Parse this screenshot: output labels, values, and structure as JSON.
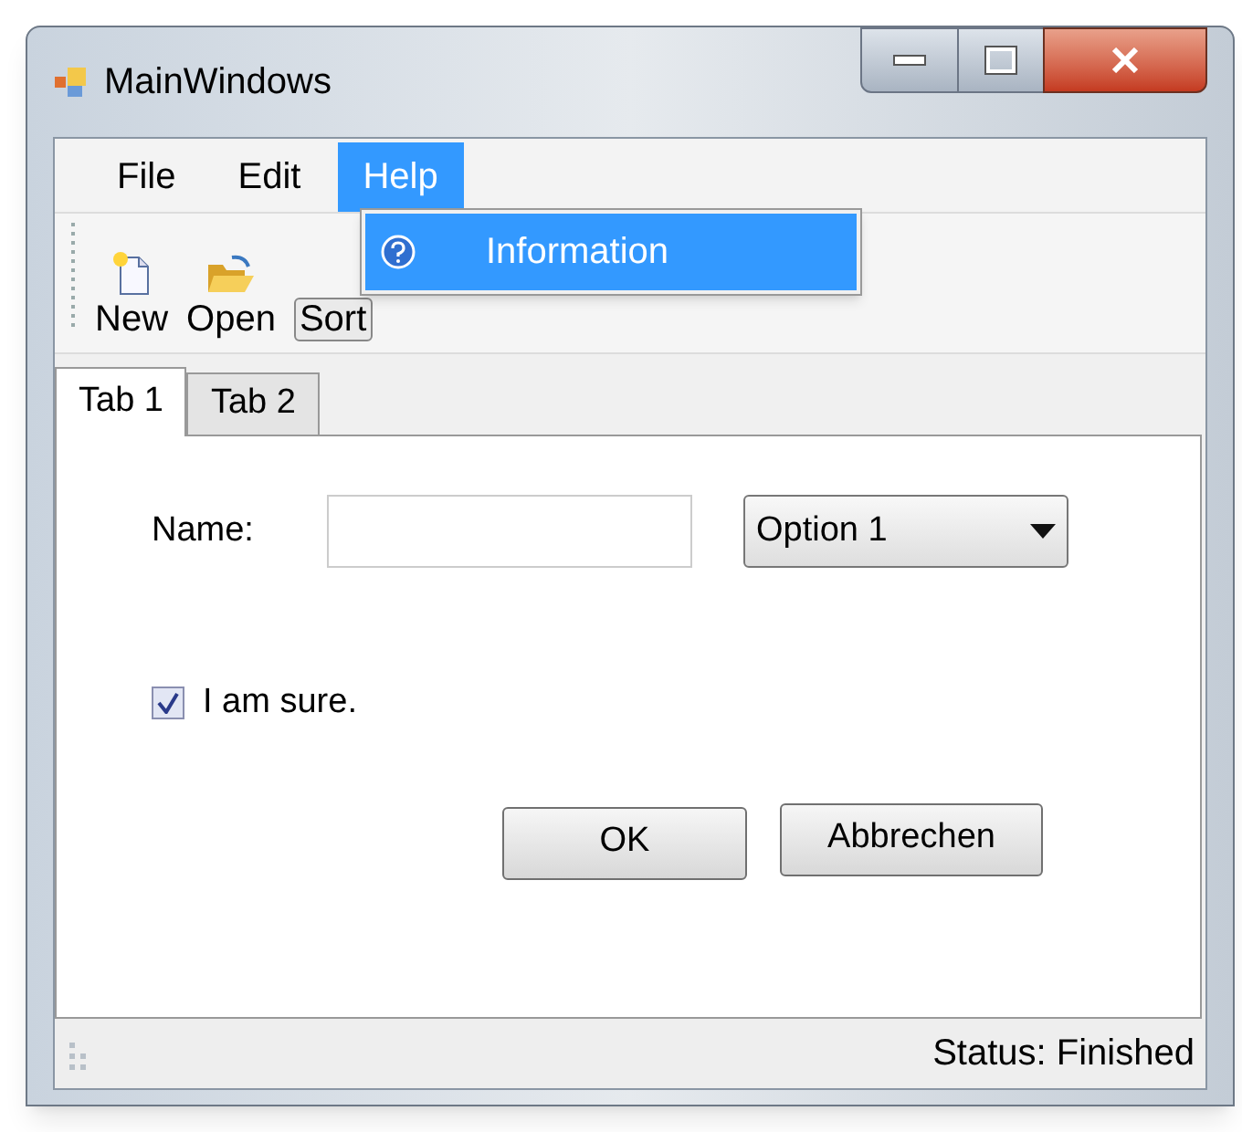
{
  "window": {
    "title": "MainWindows"
  },
  "menu": [
    {
      "label": "File",
      "selected": false
    },
    {
      "label": "Edit",
      "selected": false
    },
    {
      "label": "Help",
      "selected": true
    }
  ],
  "dropdown": [
    {
      "label": "Information",
      "selected": true
    }
  ],
  "toolbar": [
    {
      "label": "New",
      "kind": "new"
    },
    {
      "label": "Open",
      "kind": "open"
    },
    {
      "label": "Sort",
      "kind": "text"
    }
  ],
  "tabs": [
    {
      "label": "Tab 1",
      "selected": true
    },
    {
      "label": "Tab 2",
      "selected": false
    }
  ],
  "form": {
    "name_label": "Name:",
    "combo_value": "Option 1",
    "checkbox": {
      "label": "I am sure.",
      "checked": true
    },
    "buttons": [
      "OK",
      "Abbrechen"
    ]
  },
  "status_bar": "Status: Finished"
}
